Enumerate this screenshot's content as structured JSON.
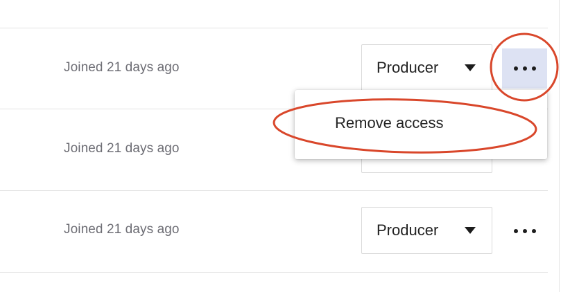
{
  "members": [
    {
      "joined": "Joined 21 days ago",
      "role": "Producer",
      "more_menu_open": true
    },
    {
      "joined": "Joined 21 days ago",
      "role": "",
      "more_menu_open": false
    },
    {
      "joined": "Joined 21 days ago",
      "role": "Producer",
      "more_menu_open": false
    }
  ],
  "menu": {
    "items": [
      {
        "label": "Remove access"
      }
    ]
  },
  "colors": {
    "annotation": "#d9472b",
    "active_button_bg": "#dde2f3",
    "secondary_text": "#6d6d74"
  },
  "icons": {
    "caret": "caret-down-icon",
    "more": "more-horizontal-icon"
  }
}
